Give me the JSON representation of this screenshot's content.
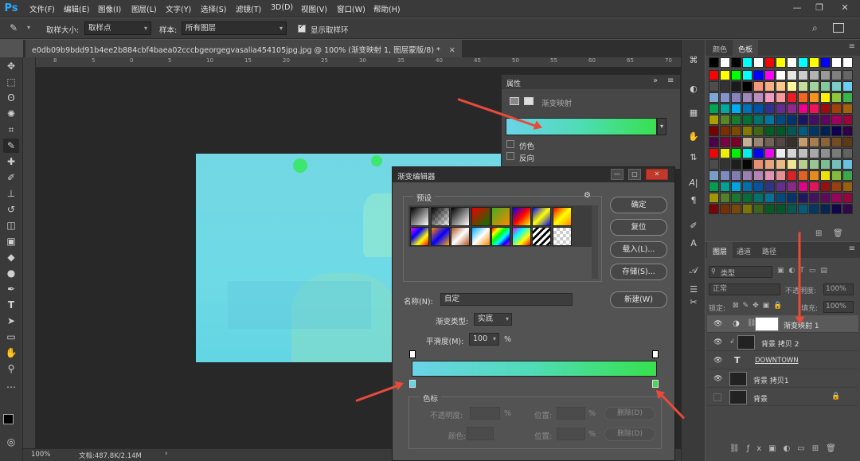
{
  "app": {
    "logo": "Ps"
  },
  "menu": [
    "文件(F)",
    "编辑(E)",
    "图像(I)",
    "图层(L)",
    "文字(Y)",
    "选择(S)",
    "滤镜(T)",
    "3D(D)",
    "视图(V)",
    "窗口(W)",
    "帮助(H)"
  ],
  "window_controls": {
    "minimize": "—",
    "restore": "❐",
    "close": "✕"
  },
  "options": {
    "sample_size_label": "取样大小:",
    "sample_size_value": "取样点",
    "sample_label": "样本:",
    "sample_value": "所有图层",
    "show_ring_label": "显示取样环"
  },
  "document": {
    "tab_title": "e0db09b9bdd91b4ee2b884cbf4baea02cccbgeorgegvasalia454105jpg.jpg @ 100% (渐变映射 1, 图层蒙版/8) *",
    "zoom": "100%",
    "doc_size": "文档:487.8K/2.14M"
  },
  "ruler_h": [
    "8",
    "5",
    "0",
    "5",
    "10",
    "15",
    "20",
    "25",
    "30",
    "35",
    "40",
    "45",
    "50",
    "55",
    "60",
    "65",
    "70"
  ],
  "swatches_panel": {
    "tabs": [
      "颜色",
      "色板"
    ]
  },
  "properties": {
    "tab": "属性",
    "type_label": "渐变映射",
    "dither_label": "仿色",
    "reverse_label": "反向",
    "expand": "»"
  },
  "layers_panel": {
    "tabs": [
      "图层",
      "通道",
      "路径"
    ],
    "filter_label": "类型",
    "blend_mode": "正常",
    "opacity_label": "不透明度:",
    "opacity_value": "100%",
    "lock_label": "锁定:",
    "fill_label": "填充:",
    "fill_value": "100%",
    "layers": [
      {
        "name": "渐变映射 1",
        "type": "adjustment"
      },
      {
        "name": "背景 拷贝 2",
        "type": "image"
      },
      {
        "name": "DOWNTOWN",
        "type": "text"
      },
      {
        "name": "背景 拷贝1",
        "type": "image"
      },
      {
        "name": "背景",
        "type": "background"
      }
    ]
  },
  "gradient_editor": {
    "title": "渐变编辑器",
    "presets_label": "预设",
    "ok": "确定",
    "reset": "复位",
    "load": "载入(L)...",
    "save": "存储(S)...",
    "name_label": "名称(N):",
    "name_value": "自定",
    "new_button": "新建(W)",
    "type_label": "渐变类型:",
    "type_value": "实底",
    "smoothness_label": "平滑度(M):",
    "smoothness_value": "100",
    "smoothness_unit": "%",
    "color_stops_label": "色标",
    "opacity_label": "不透明度:",
    "location_label": "位置:",
    "delete_label": "删除(D)",
    "color_label": "颜色:",
    "percent": "%",
    "gradient_colors": [
      "#6ad3e8",
      "#36e14d"
    ]
  },
  "colors": {
    "accent_blue": "#31a8ff",
    "arrow_red": "#e84b3a"
  }
}
